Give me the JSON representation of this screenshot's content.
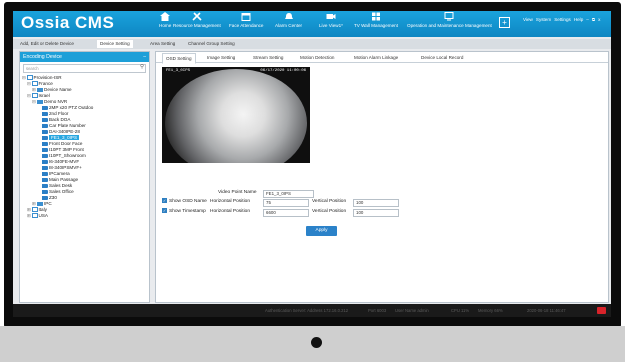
{
  "app": {
    "title": "Ossia CMS"
  },
  "nav": [
    {
      "label": "Home",
      "icon": "home-icon"
    },
    {
      "label": "Resource Management",
      "icon": "tools-icon"
    },
    {
      "label": "Face Attendance",
      "icon": "calendar-icon"
    },
    {
      "label": "Alarm Center",
      "icon": "alarm-icon"
    },
    {
      "label": "Live View1*",
      "icon": "camera-icon"
    },
    {
      "label": "TV Wall Management",
      "icon": "grid-icon"
    },
    {
      "label": "Operation and Maintenance Management",
      "icon": "monitor-icon"
    }
  ],
  "window": {
    "view": "View",
    "system": "System",
    "settings": "Settings",
    "help": "Help",
    "minimize": "–",
    "restore": "⧉",
    "close": "x"
  },
  "top_tabs": [
    {
      "label": "Add, Edit or Delete Device"
    },
    {
      "label": "Device Setting"
    },
    {
      "label": "Area Setting"
    },
    {
      "label": "Channel Group Setting"
    }
  ],
  "left": {
    "title": "Encoding Device",
    "collapse": "–",
    "search_placeholder": "search",
    "tree": [
      {
        "label": "Provision-ISR",
        "indent": 0,
        "exp": "⊟",
        "type": "home"
      },
      {
        "label": "France",
        "indent": 1,
        "exp": "⊟",
        "type": "home"
      },
      {
        "label": "Device Name",
        "indent": 2,
        "exp": "⊞",
        "type": "nvr"
      },
      {
        "label": "Israel",
        "indent": 1,
        "exp": "⊟",
        "type": "home"
      },
      {
        "label": "Demo NVR",
        "indent": 2,
        "exp": "⊟",
        "type": "nvr"
      },
      {
        "label": "2MP x20 PTZ Outdoo",
        "indent": 3,
        "exp": "",
        "type": "cam"
      },
      {
        "label": "2nd Floor",
        "indent": 3,
        "exp": "",
        "type": "cam"
      },
      {
        "label": "Back DOA",
        "indent": 3,
        "exp": "",
        "type": "cam"
      },
      {
        "label": "Car Plate Number",
        "indent": 3,
        "exp": "",
        "type": "cam"
      },
      {
        "label": "DAI-340IPE-28",
        "indent": 3,
        "exp": "",
        "type": "cam"
      },
      {
        "label": "FE1_3_0IPS",
        "indent": 3,
        "exp": "",
        "type": "cam",
        "selected": true
      },
      {
        "label": "Front Door Face",
        "indent": 3,
        "exp": "",
        "type": "cam"
      },
      {
        "label": "I10PT 3MP Front",
        "indent": 3,
        "exp": "",
        "type": "cam"
      },
      {
        "label": "I10PT_Showroom",
        "indent": 3,
        "exp": "",
        "type": "cam"
      },
      {
        "label": "I6-340FE-MVF",
        "indent": 3,
        "exp": "",
        "type": "cam"
      },
      {
        "label": "I8-340IPSMVF+",
        "indent": 3,
        "exp": "",
        "type": "cam"
      },
      {
        "label": "IPCamera",
        "indent": 3,
        "exp": "",
        "type": "cam"
      },
      {
        "label": "Main Passage",
        "indent": 3,
        "exp": "",
        "type": "cam"
      },
      {
        "label": "Sales Desk",
        "indent": 3,
        "exp": "",
        "type": "cam"
      },
      {
        "label": "Sales Office",
        "indent": 3,
        "exp": "",
        "type": "cam"
      },
      {
        "label": "Z30",
        "indent": 3,
        "exp": "",
        "type": "cam"
      },
      {
        "label": "IPC",
        "indent": 2,
        "exp": "⊞",
        "type": "nvr"
      },
      {
        "label": "Italy",
        "indent": 1,
        "exp": "⊞",
        "type": "home"
      },
      {
        "label": "USA",
        "indent": 1,
        "exp": "⊞",
        "type": "home"
      }
    ]
  },
  "right": {
    "tabs": [
      {
        "label": "OSD Setting"
      },
      {
        "label": "Image Setting"
      },
      {
        "label": "Stream Setting"
      },
      {
        "label": "Motion Detection"
      },
      {
        "label": "Motion Alarm Linkage"
      },
      {
        "label": "Device Local Record"
      }
    ],
    "video": {
      "osd_name": "FE1_3_0IPS",
      "osd_time": "06/17/2020 11:00:06"
    },
    "form": {
      "video_point_name_label": "Video Point Name",
      "video_point_name_value": "FE1_3_0IPS",
      "show_osd_name_label": "Show OSD Name",
      "show_timestamp_label": "Show Timestamp",
      "horizontal_position_label": "Horizontal Position",
      "vertical_position_label": "Vertical Position",
      "osd_h": "75",
      "osd_v": "100",
      "ts_h": "6600",
      "ts_v": "100",
      "apply_label": "Apply"
    }
  },
  "status": {
    "auth_server": "Authentication Server: Address 172.16.0.212",
    "port": "Port 6003",
    "user": "User Name admin",
    "cpu": "CPU 11%",
    "memory": "Memory 66%",
    "datetime": "2020-06-18 11:46:47"
  },
  "colors": {
    "brand_bar": "#1aa3dd",
    "accent": "#29a7e0",
    "apply": "#2b82c9",
    "status_bg": "#1a1a1a",
    "alert": "#d8232a"
  }
}
